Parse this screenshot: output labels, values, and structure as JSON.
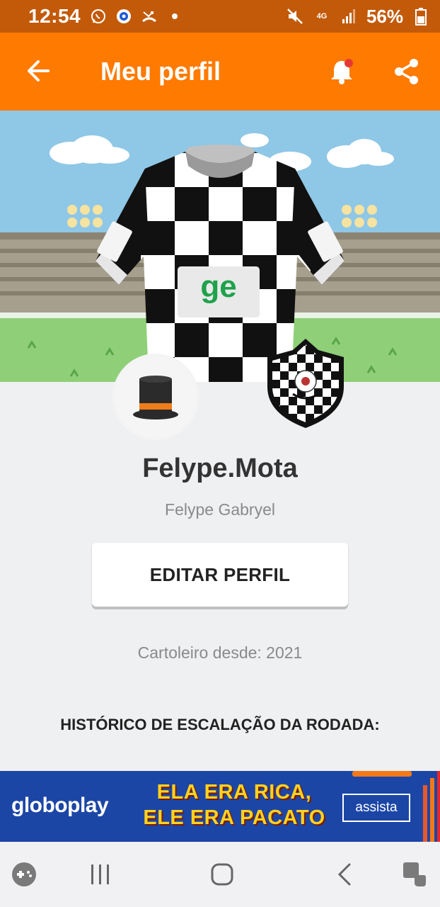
{
  "status_bar": {
    "time": "12:54",
    "network": "4G",
    "battery": "56%"
  },
  "app_bar": {
    "title": "Meu perfil"
  },
  "jersey": {
    "sponsor": "ge"
  },
  "profile": {
    "username": "Felype.Mota",
    "full_name": "Felype Gabryel",
    "edit_button": "EDITAR PERFIL",
    "member_since": "Cartoleiro desde: 2021"
  },
  "history": {
    "heading": "HISTÓRICO DE ESCALAÇÃO DA RODADA:"
  },
  "ad": {
    "brand": "globoplay",
    "headline_line1": "ELA ERA RICA,",
    "headline_line2": "ELE ERA PACATO",
    "cta": "assista"
  },
  "colors": {
    "status_bar": "#c25a0a",
    "app_bar": "#ff7a00",
    "notification_dot": "#e53935",
    "ad_background": "#1c46a6",
    "ad_headline": "#ffd21f"
  }
}
